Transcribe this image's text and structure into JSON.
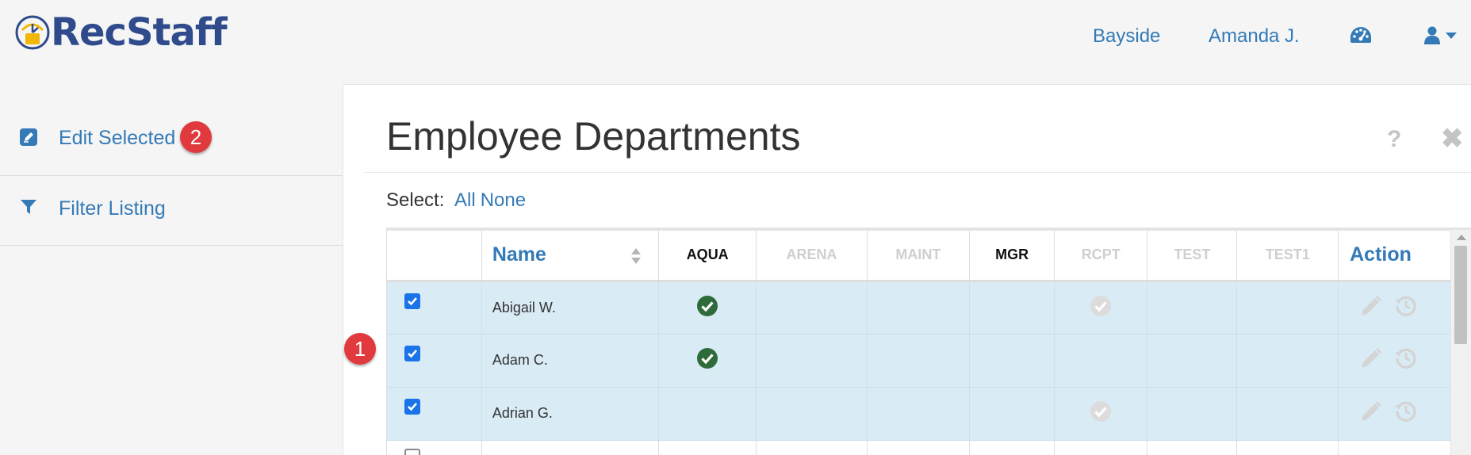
{
  "header": {
    "brand": "RecStaff",
    "location": "Bayside",
    "user": "Amanda J.",
    "dashboard_icon": "tachometer-icon",
    "account_icon": "user-icon"
  },
  "sidebar": {
    "items": [
      {
        "label": "Edit Selected",
        "icon": "edit-icon",
        "badge": "2"
      },
      {
        "label": "Filter Listing",
        "icon": "filter-icon"
      }
    ]
  },
  "annotation_badge": "1",
  "page": {
    "title": "Employee Departments",
    "help": "?",
    "close": "✖",
    "select_label": "Select:",
    "select_all": "All",
    "select_none": "None"
  },
  "table": {
    "columns": [
      {
        "label": "",
        "enabled": true
      },
      {
        "label": "Name",
        "enabled": true
      },
      {
        "label": "AQUA",
        "enabled": true
      },
      {
        "label": "ARENA",
        "enabled": false
      },
      {
        "label": "MAINT",
        "enabled": false
      },
      {
        "label": "MGR",
        "enabled": true
      },
      {
        "label": "RCPT",
        "enabled": false
      },
      {
        "label": "TEST",
        "enabled": false
      },
      {
        "label": "TEST1",
        "enabled": false
      },
      {
        "label": "Action",
        "enabled": true
      }
    ],
    "rows": [
      {
        "name": "Abigail W.",
        "selected": true,
        "AQUA": "active",
        "RCPT": "inactive"
      },
      {
        "name": "Adam C.",
        "selected": true,
        "AQUA": "active"
      },
      {
        "name": "Adrian G.",
        "selected": true,
        "RCPT": "inactive"
      }
    ]
  },
  "colors": {
    "brand": "#2f4b8c",
    "link": "#337ab7",
    "row_selected": "#d9ebf5",
    "badge": "#e0393e",
    "check_active": "#2e6b3a",
    "check_inactive": "#dcdcdc"
  }
}
